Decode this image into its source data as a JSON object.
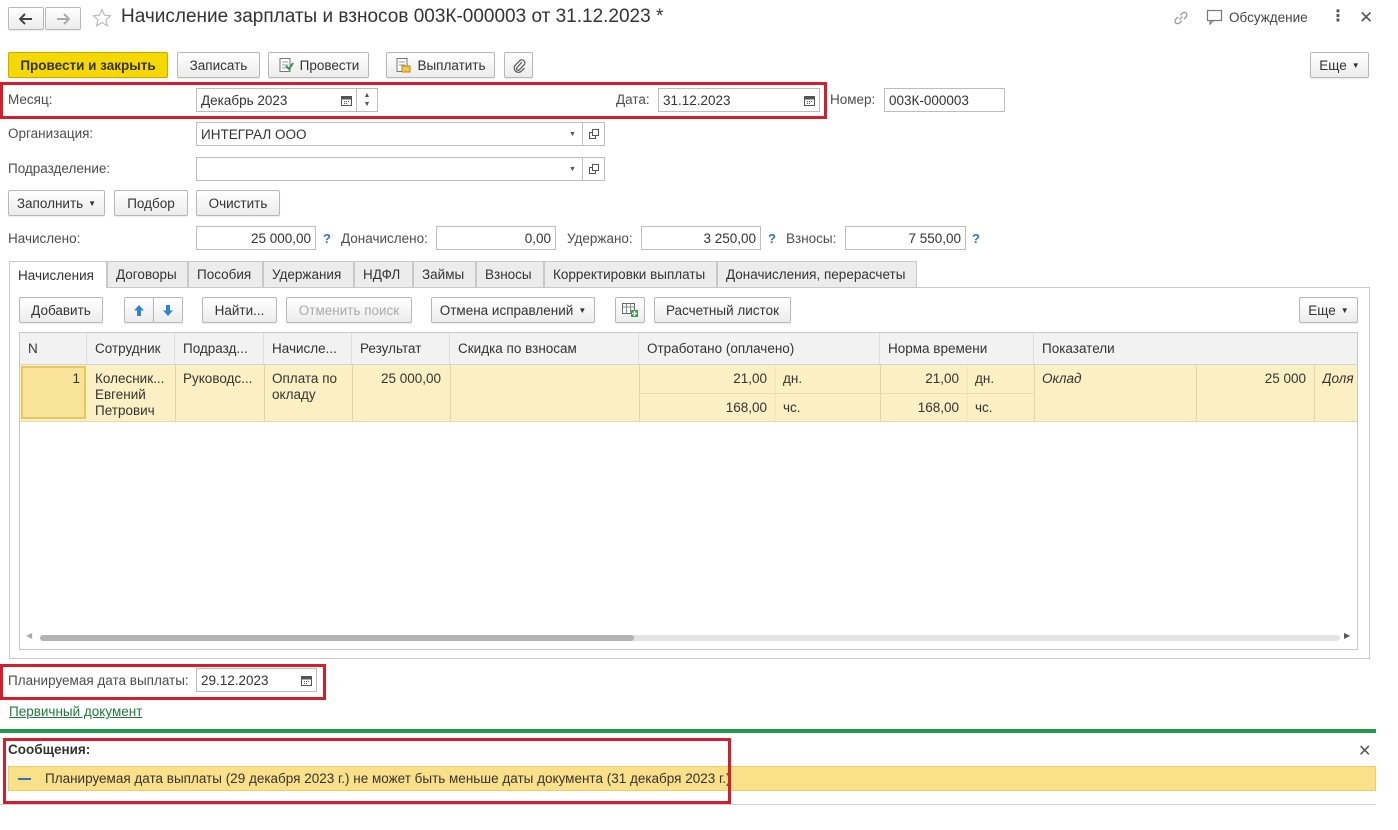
{
  "window": {
    "title": "Начисление зарплаты и взносов 003К-000003 от 31.12.2023 *",
    "discussion_label": "Обсуждение"
  },
  "toolbar": {
    "post_close": "Провести и закрыть",
    "save": "Записать",
    "post": "Провести",
    "pay": "Выплатить",
    "more": "Еще"
  },
  "header": {
    "month_label": "Месяц:",
    "month_value": "Декабрь 2023",
    "date_label": "Дата:",
    "date_value": "31.12.2023",
    "number_label": "Номер:",
    "number_value": "003К-000003",
    "org_label": "Организация:",
    "org_value": "ИНТЕГРАЛ ООО",
    "dept_label": "Подразделение:",
    "dept_value": ""
  },
  "actions": {
    "fill": "Заполнить",
    "pick": "Подбор",
    "clear": "Очистить"
  },
  "totals": {
    "accrued_label": "Начислено:",
    "accrued_value": "25 000,00",
    "additional_label": "Доначислено:",
    "additional_value": "0,00",
    "withheld_label": "Удержано:",
    "withheld_value": "3 250,00",
    "contrib_label": "Взносы:",
    "contrib_value": "7 550,00",
    "help": "?"
  },
  "tabs": [
    {
      "label": "Начисления"
    },
    {
      "label": "Договоры"
    },
    {
      "label": "Пособия"
    },
    {
      "label": "Удержания"
    },
    {
      "label": "НДФЛ"
    },
    {
      "label": "Займы"
    },
    {
      "label": "Взносы"
    },
    {
      "label": "Корректировки выплаты"
    },
    {
      "label": "Доначисления, перерасчеты"
    }
  ],
  "table_toolbar": {
    "add": "Добавить",
    "find": "Найти...",
    "cancel_search": "Отменить поиск",
    "cancel_corrections": "Отмена исправлений",
    "payslip": "Расчетный листок",
    "more": "Еще"
  },
  "table": {
    "columns": [
      "N",
      "Сотрудник",
      "Подразд...",
      "Начисле...",
      "Результат",
      "Скидка по взносам",
      "Отработано (оплачено)",
      "Норма времени",
      "Показатели"
    ],
    "row": {
      "n": "1",
      "employee": [
        "Колесник...",
        "Евгений",
        "Петрович"
      ],
      "dept": "Руководс...",
      "accrual": [
        "Оплата по",
        "окладу"
      ],
      "result": "25 000,00",
      "discount": "",
      "worked_days": "21,00",
      "worked_days_unit": "дн.",
      "worked_hours": "168,00",
      "worked_hours_unit": "чс.",
      "norm_days": "21,00",
      "norm_days_unit": "дн.",
      "norm_hours": "168,00",
      "norm_hours_unit": "чс.",
      "indicator_name": "Оклад",
      "indicator_value": "25 000",
      "indicator_extra": "Доля ..."
    }
  },
  "footer": {
    "pay_date_label": "Планируемая дата выплаты:",
    "pay_date_value": "29.12.2023",
    "primary_doc_link": "Первичный документ"
  },
  "messages": {
    "title": "Сообщения:",
    "items": [
      {
        "text": "Планируемая дата выплаты (29 декабря 2023 г.) не может быть меньше даты документа (31 декабря 2023 г.)"
      }
    ]
  },
  "colors": {
    "primary_button": "#f5d800",
    "highlight_frame": "#d0202e",
    "selected_row": "#fbf0c3",
    "message_bar": "#fbe08a",
    "separator_green": "#1d9a4a",
    "link": "#1d7a3a"
  }
}
